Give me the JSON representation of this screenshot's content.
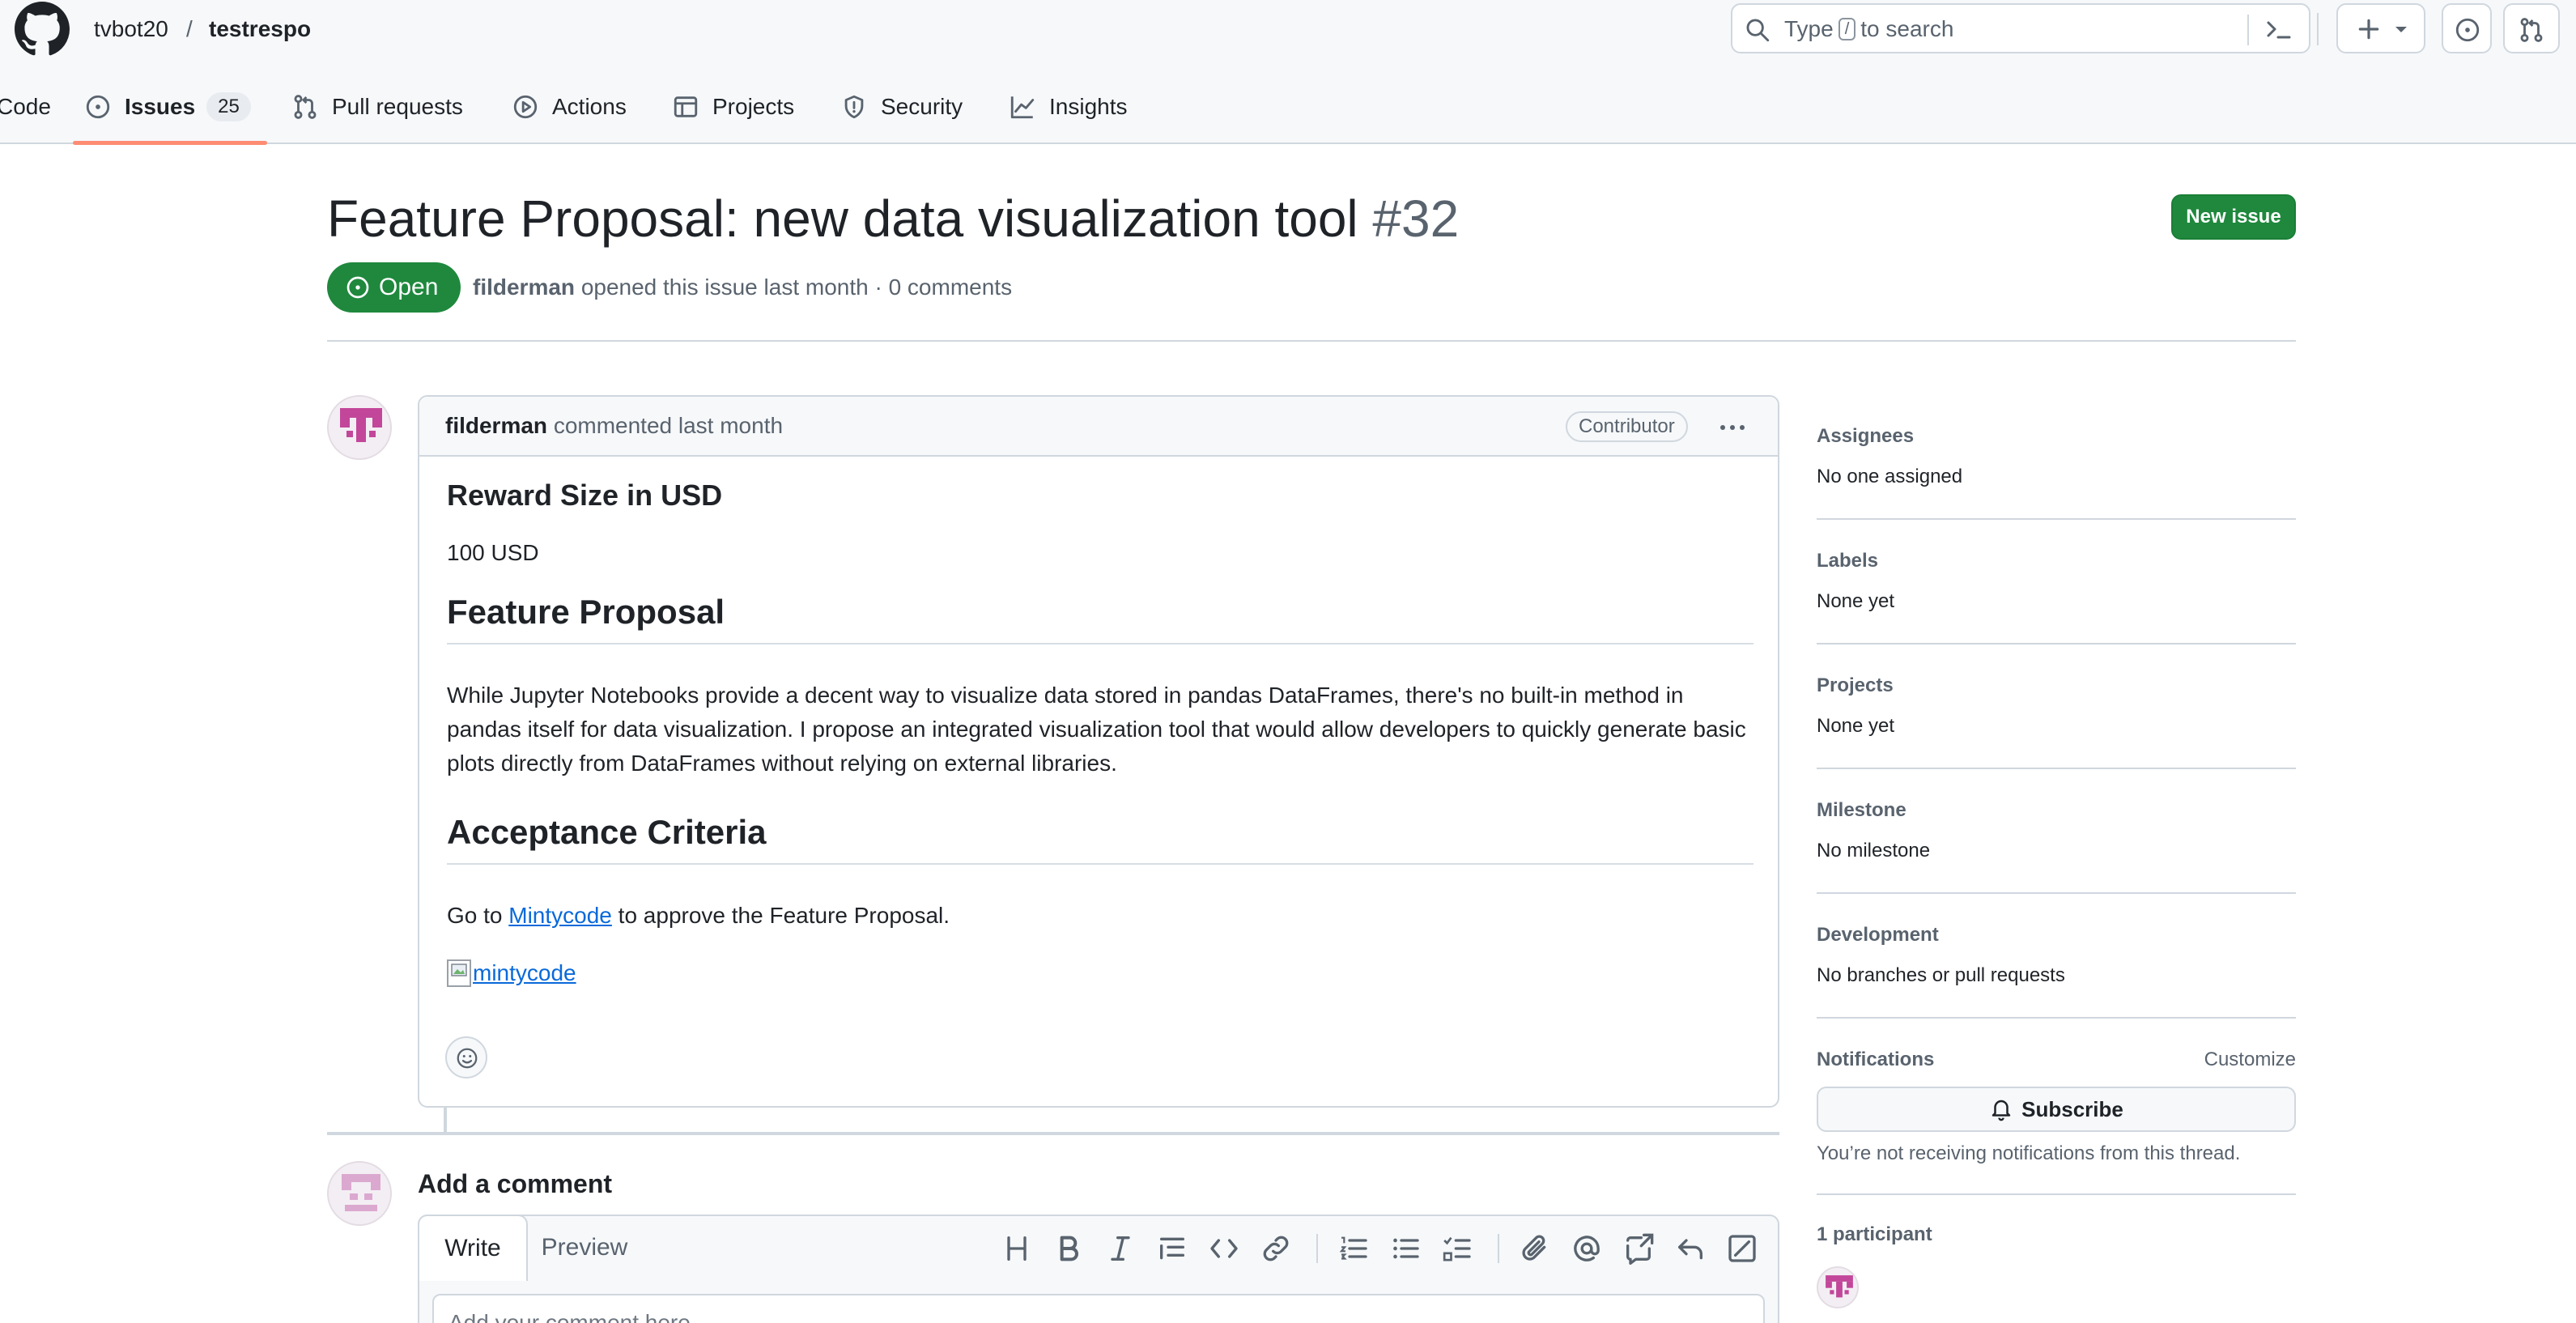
{
  "header": {
    "owner": "tvbot20",
    "separator": "/",
    "repo": "testrespo",
    "search": {
      "prefix": "Type",
      "key": "/",
      "suffix": "to search"
    },
    "icons": [
      "github-logo-icon",
      "search-icon",
      "command-palette-icon",
      "plus-icon",
      "issue-opened-icon",
      "git-pull-request-icon"
    ]
  },
  "nav": {
    "code": "Code",
    "issues": "Issues",
    "issues_count": "25",
    "pulls": "Pull requests",
    "actions": "Actions",
    "projects": "Projects",
    "security": "Security",
    "insights": "Insights"
  },
  "issue": {
    "title": "Feature Proposal: new data visualization tool",
    "number": "#32",
    "state": "Open",
    "author": "filderman",
    "meta_rest": "opened this issue last month · 0 comments",
    "new_issue_label": "New issue"
  },
  "comment": {
    "author": "filderman",
    "when": "commented last month",
    "role_badge": "Contributor",
    "reward_heading": "Reward Size in USD",
    "reward_value": "100 USD",
    "proposal_heading": "Feature Proposal",
    "proposal_text": "While Jupyter Notebooks provide a decent way to visualize data stored in pandas DataFrames, there's no built-in method in pandas itself for data visualization. I propose an integrated visualization tool that would allow developers to quickly generate basic plots directly from DataFrames without relying on external libraries.",
    "criteria_heading": "Acceptance Criteria",
    "criteria_before": "Go to",
    "criteria_link": "Mintycode",
    "criteria_after": "to approve the Feature Proposal.",
    "image_alt": "mintycode"
  },
  "add_comment": {
    "title": "Add a comment",
    "write_tab": "Write",
    "preview_tab": "Preview",
    "placeholder": "Add your comment here..."
  },
  "sidebar": {
    "assignees_label": "Assignees",
    "assignees_value": "No one assigned",
    "labels_label": "Labels",
    "labels_value": "None yet",
    "projects_label": "Projects",
    "projects_value": "None yet",
    "milestone_label": "Milestone",
    "milestone_value": "No milestone",
    "development_label": "Development",
    "development_value": "No branches or pull requests",
    "notifications_label": "Notifications",
    "customize_label": "Customize",
    "subscribe_label": "Subscribe",
    "notifications_note": "You’re not receiving notifications from this thread.",
    "participants_label": "1 participant"
  },
  "colors": {
    "open_green": "#1f883d",
    "link_blue": "#0969da",
    "tab_underline": "#fd8c73",
    "avatar_pink": "#c2479a"
  }
}
